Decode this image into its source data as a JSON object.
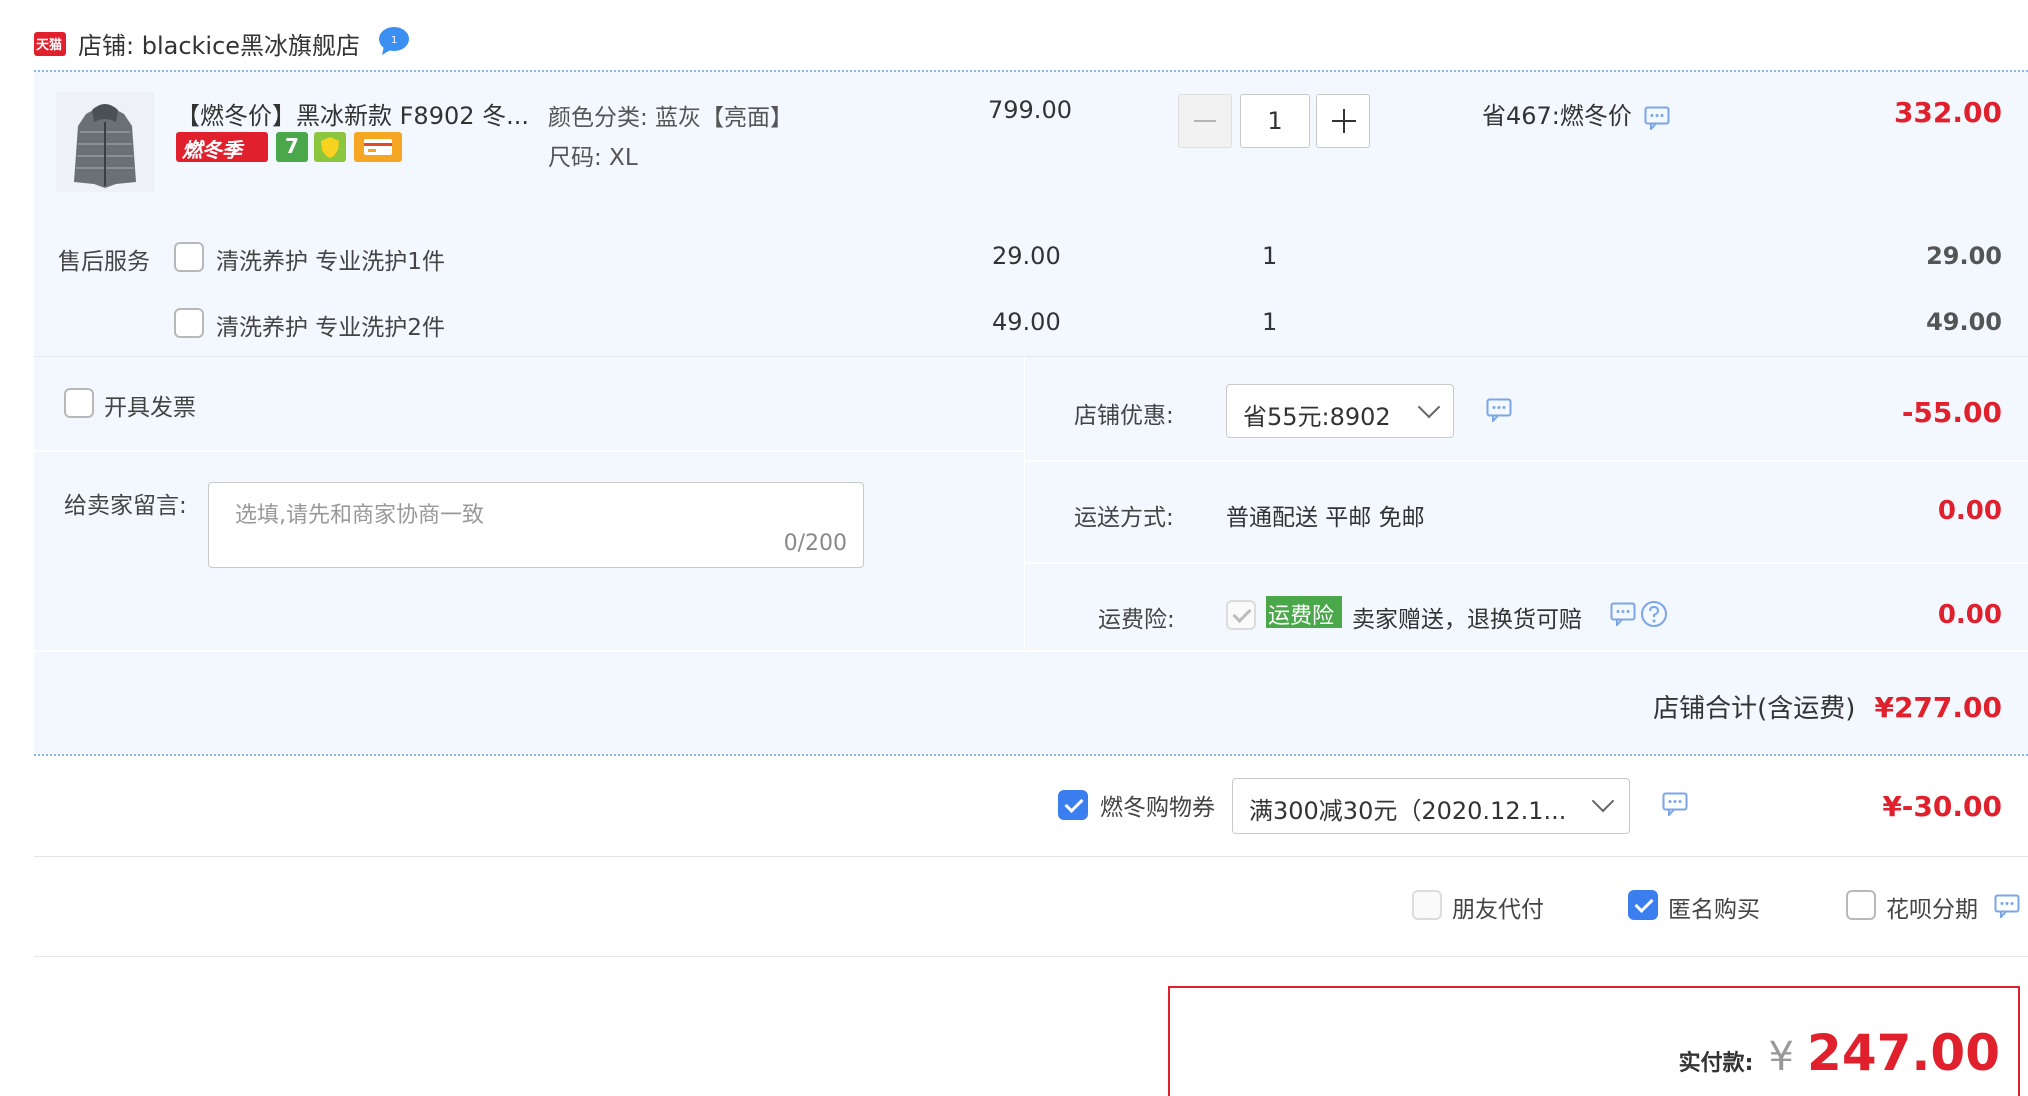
{
  "shop": {
    "badge": "天猫",
    "label": "店铺: blackice黑冰旗舰店",
    "chat_icon": "blue-chat-bubble-icon"
  },
  "product": {
    "title": "【燃冬价】黑冰新款 F8902 冬...",
    "tags": {
      "season": "燃冬季",
      "seven": "7"
    },
    "color_label": "颜色分类: 蓝灰【亮面】",
    "size_label": "尺码: XL",
    "unit_price": "799.00",
    "quantity": "1",
    "save_label": "省467:燃冬价",
    "subtotal": "332.00"
  },
  "after_sales": {
    "label": "售后服务",
    "items": [
      {
        "name": "清洗养护 专业洗护1件",
        "price": "29.00",
        "qty": "1",
        "total": "29.00",
        "checked": false
      },
      {
        "name": "清洗养护 专业洗护2件",
        "price": "49.00",
        "qty": "1",
        "total": "49.00",
        "checked": false
      }
    ]
  },
  "invoice": {
    "label": "开具发票",
    "checked": false
  },
  "message": {
    "label": "给卖家留言:",
    "placeholder": "选填,请先和商家协商一致",
    "counter": "0/200"
  },
  "shop_discount": {
    "label": "店铺优惠:",
    "selected": "省55元:8902",
    "amount": "-55.00"
  },
  "shipping": {
    "label": "运送方式:",
    "value": "普通配送 平邮 免邮",
    "amount": "0.00"
  },
  "insurance": {
    "label": "运费险:",
    "badge": "运费险",
    "desc": "卖家赠送，退换货可赔",
    "amount": "0.00"
  },
  "shop_total": {
    "label": "店铺合计(含运费)",
    "amount": "¥277.00"
  },
  "coupon": {
    "label": "燃冬购物券",
    "selected": "满300减30元（2020.12.1...",
    "amount": "¥-30.00",
    "checked": true
  },
  "options": {
    "friend_pay": {
      "label": "朋友代付",
      "checked": false
    },
    "anonymous": {
      "label": "匿名购买",
      "checked": true
    },
    "huabei": {
      "label": "花呗分期",
      "checked": false
    }
  },
  "payment": {
    "label": "实付款:",
    "currency": "¥",
    "amount": "247.00"
  },
  "colors": {
    "accent_red": "#e0212d",
    "checkbox_blue": "#3b7ef0",
    "section_bg": "#f3f8fe",
    "insurance_green": "#4aa84a"
  }
}
